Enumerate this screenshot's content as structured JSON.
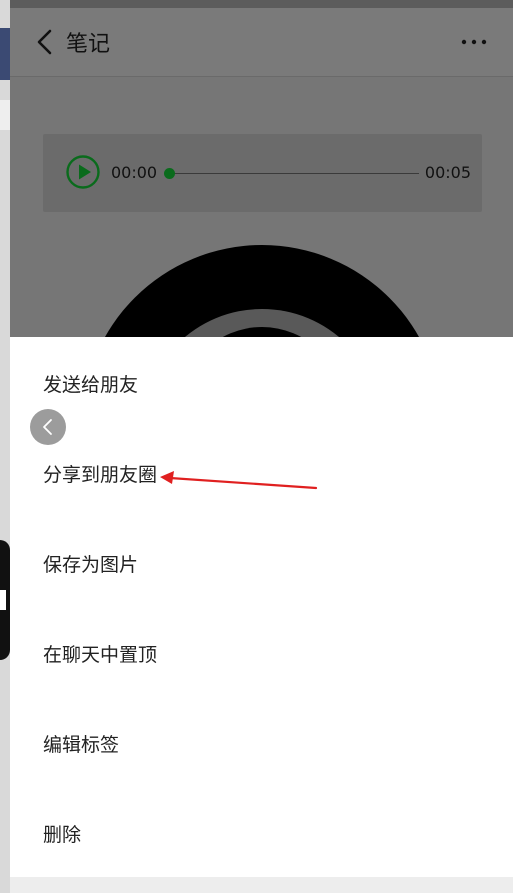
{
  "header": {
    "title": "笔记"
  },
  "audio": {
    "current_time": "00:00",
    "duration": "00:05",
    "progress": 0
  },
  "sheet": {
    "items": [
      "发送给朋友",
      "分享到朋友圈",
      "保存为图片",
      "在聊天中置顶",
      "编辑标签",
      "删除"
    ]
  },
  "colors": {
    "play_accent": "#0a6b1c",
    "annotation_arrow": "#e02020",
    "overlay": "#767676",
    "sheet_bg": "#ffffff"
  }
}
